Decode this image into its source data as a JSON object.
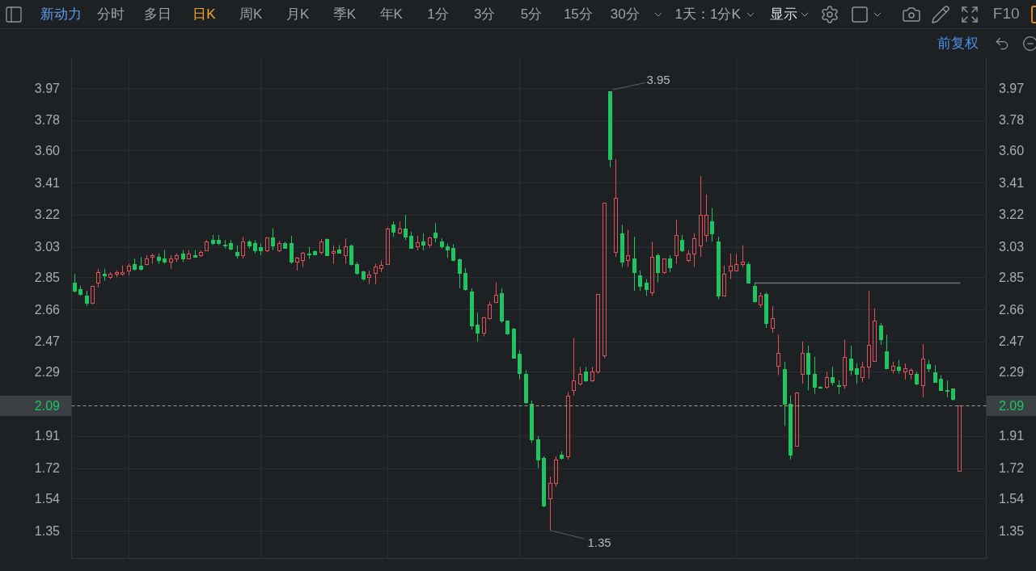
{
  "toolbar": {
    "stock_name": "新动力",
    "periods": [
      {
        "label": "分时",
        "selected": false
      },
      {
        "label": "多日",
        "selected": false
      },
      {
        "label": "日K",
        "selected": true
      },
      {
        "label": "周K",
        "selected": false
      },
      {
        "label": "月K",
        "selected": false
      },
      {
        "label": "季K",
        "selected": false
      },
      {
        "label": "年K",
        "selected": false
      },
      {
        "label": "1分",
        "selected": false
      },
      {
        "label": "3分",
        "selected": false
      },
      {
        "label": "5分",
        "selected": false
      },
      {
        "label": "15分",
        "selected": false
      },
      {
        "label": "30分",
        "selected": false
      }
    ],
    "range": "1天：1分K",
    "display": "显示",
    "f10": "F10"
  },
  "subbar": {
    "adjustment": "前复权"
  },
  "chart": {
    "chart_data": {
      "type": "candlestick",
      "grid": true,
      "categories": [
        null,
        null,
        null,
        null,
        null,
        null,
        null,
        null,
        null,
        null,
        null,
        null,
        null,
        null,
        null,
        null,
        null,
        null,
        null,
        null,
        null,
        null,
        null,
        null,
        null,
        null,
        null,
        null,
        null,
        null,
        null,
        null,
        null,
        null,
        null,
        null,
        null,
        null,
        null,
        null,
        null,
        null,
        null,
        null,
        null,
        null,
        null,
        null,
        null,
        null,
        null,
        null,
        null,
        null,
        null,
        null,
        null,
        null,
        null,
        null,
        null,
        null,
        null,
        null,
        null,
        null,
        null,
        null,
        null,
        null,
        null,
        null,
        null,
        null,
        null,
        null,
        null,
        null,
        null,
        null,
        null,
        null,
        null,
        null,
        null,
        null,
        null,
        null,
        null,
        null,
        null,
        null,
        null,
        null,
        null,
        null,
        null,
        null,
        null,
        null,
        null,
        null,
        null,
        null,
        null,
        null,
        null,
        null,
        null,
        null,
        null,
        null,
        null,
        null,
        null,
        null,
        null,
        null,
        null,
        null,
        null,
        null,
        null,
        null,
        null,
        null,
        null,
        null,
        null,
        null,
        null,
        null,
        null,
        null,
        null,
        null,
        null,
        null,
        null,
        null,
        null,
        null,
        null,
        null,
        null,
        null,
        null,
        null,
        null,
        null,
        null,
        null
      ],
      "ohlc": [
        [
          2.82,
          2.87,
          2.76,
          2.77
        ],
        [
          2.78,
          2.8,
          2.74,
          2.75
        ],
        [
          2.74,
          2.77,
          2.68,
          2.7
        ],
        [
          2.7,
          2.8,
          2.69,
          2.8
        ],
        [
          2.82,
          2.9,
          2.79,
          2.88
        ],
        [
          2.87,
          2.9,
          2.83,
          2.86
        ],
        [
          2.85,
          2.88,
          2.84,
          2.87
        ],
        [
          2.87,
          2.89,
          2.85,
          2.88
        ],
        [
          2.87,
          2.92,
          2.86,
          2.88
        ],
        [
          2.89,
          2.93,
          2.86,
          2.92
        ],
        [
          2.93,
          2.96,
          2.89,
          2.9
        ],
        [
          2.92,
          2.97,
          2.89,
          2.9
        ],
        [
          2.93,
          2.98,
          2.92,
          2.96
        ],
        [
          2.97,
          2.99,
          2.93,
          2.98
        ],
        [
          2.97,
          2.99,
          2.93,
          2.95
        ],
        [
          2.96,
          3.01,
          2.93,
          2.94
        ],
        [
          2.94,
          2.98,
          2.9,
          2.96
        ],
        [
          2.96,
          2.99,
          2.94,
          2.98
        ],
        [
          2.99,
          3.01,
          2.94,
          2.96
        ],
        [
          2.96,
          3.01,
          2.96,
          2.99
        ],
        [
          2.98,
          3.01,
          2.97,
          2.97
        ],
        [
          2.98,
          3.01,
          2.97,
          3.0
        ],
        [
          3.01,
          3.07,
          3.01,
          3.06
        ],
        [
          3.07,
          3.1,
          3.04,
          3.05
        ],
        [
          3.07,
          3.1,
          3.04,
          3.05
        ],
        [
          3.045,
          3.07,
          3.02,
          3.04
        ],
        [
          3.05,
          3.07,
          3.01,
          3.02
        ],
        [
          3.0,
          3.04,
          2.96,
          2.98
        ],
        [
          2.98,
          3.09,
          2.96,
          3.06
        ],
        [
          3.06,
          3.07,
          3.02,
          3.04
        ],
        [
          3.05,
          3.07,
          2.99,
          3.01
        ],
        [
          3.03,
          3.05,
          2.98,
          3.01
        ],
        [
          3.01,
          3.085,
          3.0,
          3.085
        ],
        [
          3.085,
          3.14,
          3.01,
          3.04
        ],
        [
          3.01,
          3.065,
          3.0,
          3.05
        ],
        [
          3.05,
          3.06,
          3.02,
          3.025
        ],
        [
          3.05,
          3.095,
          2.93,
          2.94
        ],
        [
          2.94,
          2.97,
          2.89,
          2.965
        ],
        [
          2.95,
          3.0,
          2.91,
          2.995
        ],
        [
          2.99,
          3.03,
          2.96,
          2.985
        ],
        [
          3.005,
          3.01,
          2.98,
          2.985
        ],
        [
          3.0,
          3.075,
          2.985,
          3.06
        ],
        [
          3.075,
          3.08,
          2.975,
          2.98
        ],
        [
          2.996,
          3.04,
          2.93,
          3.005
        ],
        [
          3.015,
          3.04,
          2.99,
          2.995
        ],
        [
          2.98,
          3.08,
          2.93,
          3.035
        ],
        [
          3.04,
          3.045,
          2.92,
          2.93
        ],
        [
          2.93,
          2.94,
          2.865,
          2.875
        ],
        [
          2.885,
          2.89,
          2.83,
          2.84
        ],
        [
          2.85,
          2.89,
          2.81,
          2.865
        ],
        [
          2.875,
          2.93,
          2.81,
          2.915
        ],
        [
          2.905,
          2.95,
          2.88,
          2.925
        ],
        [
          2.93,
          3.145,
          2.93,
          3.14
        ],
        [
          3.16,
          3.18,
          3.09,
          3.12
        ],
        [
          3.115,
          3.18,
          3.105,
          3.14
        ],
        [
          3.14,
          3.22,
          3.07,
          3.09
        ],
        [
          3.095,
          3.12,
          3.02,
          3.025
        ],
        [
          3.034,
          3.095,
          3.01,
          3.055
        ],
        [
          3.062,
          3.11,
          3.01,
          3.043
        ],
        [
          3.043,
          3.09,
          3.025,
          3.086
        ],
        [
          3.115,
          3.17,
          3.057,
          3.086
        ],
        [
          3.062,
          3.08,
          3.02,
          3.033
        ],
        [
          3.033,
          3.05,
          2.965,
          3.015
        ],
        [
          3.024,
          3.047,
          2.945,
          2.95
        ],
        [
          2.957,
          2.96,
          2.785,
          2.875
        ],
        [
          2.875,
          2.905,
          2.77,
          2.78
        ],
        [
          2.765,
          2.785,
          2.54,
          2.565
        ],
        [
          2.57,
          2.64,
          2.47,
          2.52
        ],
        [
          2.52,
          2.615,
          2.5,
          2.613
        ],
        [
          2.608,
          2.707,
          2.6,
          2.69
        ],
        [
          2.703,
          2.82,
          2.7,
          2.747
        ],
        [
          2.756,
          2.785,
          2.58,
          2.593
        ],
        [
          2.593,
          2.595,
          2.51,
          2.517
        ],
        [
          2.546,
          2.55,
          2.37,
          2.373
        ],
        [
          2.398,
          2.42,
          2.245,
          2.283
        ],
        [
          2.28,
          2.3,
          2.1,
          2.11
        ],
        [
          2.1,
          2.12,
          1.87,
          1.89
        ],
        [
          1.89,
          1.91,
          1.72,
          1.77
        ],
        [
          1.78,
          1.79,
          1.49,
          1.5
        ],
        [
          1.54,
          1.67,
          1.35,
          1.63
        ],
        [
          1.63,
          1.79,
          1.61,
          1.77
        ],
        [
          1.8,
          1.82,
          1.77,
          1.78
        ],
        [
          1.79,
          2.17,
          1.77,
          2.15
        ],
        [
          2.18,
          2.49,
          2.15,
          2.24
        ],
        [
          2.22,
          2.32,
          2.21,
          2.28
        ],
        [
          2.29,
          2.32,
          2.23,
          2.24
        ],
        [
          2.24,
          2.32,
          2.23,
          2.29
        ],
        [
          2.29,
          2.75,
          2.28,
          2.75
        ],
        [
          2.39,
          3.29,
          2.37,
          3.29
        ],
        [
          3.95,
          3.95,
          3.5,
          3.55
        ],
        [
          3.0,
          3.55,
          2.97,
          3.32
        ],
        [
          3.11,
          3.16,
          2.91,
          2.94
        ],
        [
          2.95,
          3.13,
          2.91,
          2.98
        ],
        [
          2.96,
          3.09,
          2.77,
          2.88
        ],
        [
          2.86,
          2.89,
          2.77,
          2.8
        ],
        [
          2.82,
          2.84,
          2.74,
          2.78
        ],
        [
          2.76,
          3.06,
          2.74,
          2.97
        ],
        [
          2.98,
          2.99,
          2.82,
          2.88
        ],
        [
          2.88,
          2.96,
          2.87,
          2.96
        ],
        [
          2.96,
          2.98,
          2.88,
          2.91
        ],
        [
          2.98,
          3.19,
          2.93,
          3.1
        ],
        [
          3.07,
          3.1,
          3.0,
          3.01
        ],
        [
          2.95,
          3.01,
          2.94,
          2.99
        ],
        [
          2.99,
          3.11,
          2.91,
          3.08
        ],
        [
          3.04,
          3.45,
          2.97,
          3.22
        ],
        [
          3.1,
          3.34,
          3.06,
          3.22
        ],
        [
          3.18,
          3.26,
          3.06,
          3.11
        ],
        [
          3.06,
          3.09,
          2.72,
          2.74
        ],
        [
          2.74,
          2.92,
          2.74,
          2.87
        ],
        [
          2.89,
          2.99,
          2.84,
          2.92
        ],
        [
          2.89,
          2.99,
          2.89,
          2.93
        ],
        [
          2.93,
          3.04,
          2.91,
          2.94
        ],
        [
          2.93,
          2.94,
          2.82,
          2.82
        ],
        [
          2.8,
          2.82,
          2.7,
          2.71
        ],
        [
          2.69,
          2.76,
          2.67,
          2.74
        ],
        [
          2.75,
          2.76,
          2.55,
          2.58
        ],
        [
          2.55,
          2.68,
          2.52,
          2.61
        ],
        [
          2.325,
          2.51,
          2.27,
          2.4
        ],
        [
          2.306,
          2.35,
          1.97,
          2.1
        ],
        [
          2.1,
          2.15,
          1.77,
          1.8
        ],
        [
          1.852,
          2.17,
          1.85,
          2.168
        ],
        [
          2.278,
          2.47,
          2.22,
          2.4
        ],
        [
          2.4,
          2.445,
          2.18,
          2.28
        ],
        [
          2.28,
          2.38,
          2.16,
          2.2
        ],
        [
          2.2,
          2.205,
          2.19,
          2.197
        ],
        [
          2.2,
          2.29,
          2.19,
          2.26
        ],
        [
          2.26,
          2.32,
          2.21,
          2.23
        ],
        [
          2.21,
          2.24,
          2.16,
          2.205
        ],
        [
          2.21,
          2.48,
          2.19,
          2.38
        ],
        [
          2.37,
          2.445,
          2.27,
          2.3
        ],
        [
          2.31,
          2.34,
          2.22,
          2.28
        ],
        [
          2.26,
          2.35,
          2.23,
          2.32
        ],
        [
          2.32,
          2.77,
          2.25,
          2.45
        ],
        [
          2.355,
          2.665,
          2.35,
          2.595
        ],
        [
          2.565,
          2.58,
          2.45,
          2.485
        ],
        [
          2.41,
          2.51,
          2.31,
          2.31
        ],
        [
          2.3,
          2.35,
          2.28,
          2.325
        ],
        [
          2.32,
          2.36,
          2.28,
          2.3
        ],
        [
          2.29,
          2.34,
          2.245,
          2.31
        ],
        [
          2.28,
          2.31,
          2.245,
          2.3
        ],
        [
          2.28,
          2.29,
          2.21,
          2.22
        ],
        [
          2.21,
          2.455,
          2.14,
          2.37
        ],
        [
          2.335,
          2.36,
          2.29,
          2.31
        ],
        [
          2.288,
          2.33,
          2.23,
          2.23
        ],
        [
          2.25,
          2.27,
          2.18,
          2.18
        ],
        [
          2.182,
          2.24,
          2.14,
          2.178
        ],
        [
          2.19,
          2.19,
          2.12,
          2.13
        ],
        [
          1.705,
          2.09,
          1.705,
          2.09
        ],
        null,
        null,
        null,
        null
      ],
      "ylim": [
        1.183,
        4.147
      ],
      "yticks": [
        {
          "value": 3.97,
          "label": "3.97"
        },
        {
          "value": 3.78,
          "label": "3.78"
        },
        {
          "value": 3.6,
          "label": "3.60"
        },
        {
          "value": 3.41,
          "label": "3.41"
        },
        {
          "value": 3.22,
          "label": "3.22"
        },
        {
          "value": 3.03,
          "label": "3.03"
        },
        {
          "value": 2.85,
          "label": "2.85"
        },
        {
          "value": 2.66,
          "label": "2.66"
        },
        {
          "value": 2.47,
          "label": "2.47"
        },
        {
          "value": 2.29,
          "label": "2.29"
        },
        {
          "value": 1.91,
          "label": "1.91"
        },
        {
          "value": 1.72,
          "label": "1.72"
        },
        {
          "value": 1.54,
          "label": "1.54"
        },
        {
          "value": 1.35,
          "label": "1.35"
        }
      ],
      "ref_lines": [
        {
          "axis": "y",
          "value": 2.82
        },
        {
          "axis": "y",
          "value": 2.09,
          "label": "2.09"
        }
      ]
    },
    "right_axis": [
      "3.97",
      "3.78",
      "3.60",
      "3.41",
      "3.22",
      "3.03",
      "2.85",
      "2.66",
      "2.47",
      "2.29",
      "1.91",
      "1.72",
      "1.54",
      "1.35"
    ],
    "right_price_label": "2.09",
    "high_label": "3.95",
    "low_label": "1.35"
  }
}
